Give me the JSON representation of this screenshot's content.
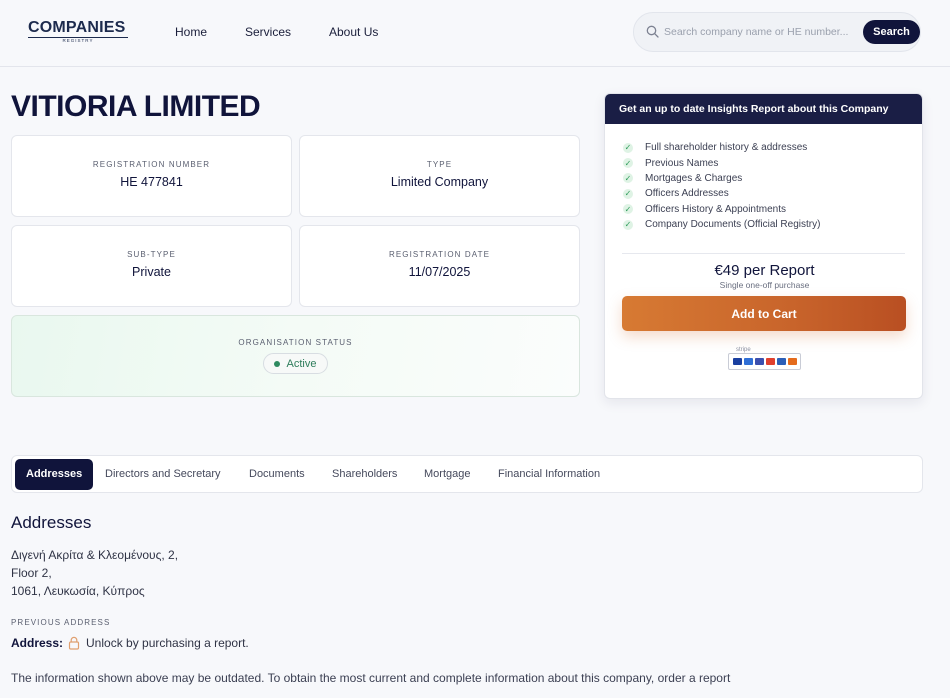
{
  "header": {
    "logo_text": "COMPANIES",
    "logo_sub": "REGISTRY",
    "nav": [
      "Home",
      "Services",
      "About Us"
    ],
    "search_placeholder": "Search company name or HE number...",
    "search_button": "Search"
  },
  "company": {
    "name": "VITIORIA LIMITED",
    "registration_number_label": "REGISTRATION NUMBER",
    "registration_number": "HE 477841",
    "type_label": "TYPE",
    "type": "Limited Company",
    "subtype_label": "SUB-TYPE",
    "subtype": "Private",
    "registration_date_label": "REGISTRATION DATE",
    "registration_date": "11/07/2025",
    "status_label": "ORGANISATION STATUS",
    "status": "Active"
  },
  "report": {
    "heading": "Get an up to date Insights Report about this Company",
    "features": [
      "Full shareholder history & addresses",
      "Previous Names",
      "Mortgages & Charges",
      "Officers Addresses",
      "Officers History & Appointments",
      "Company Documents (Official Registry)"
    ],
    "price": "€49 per Report",
    "price_note": "Single one-off purchase",
    "cart_button": "Add to Cart",
    "payment_label": "stripe"
  },
  "tabs": [
    "Addresses",
    "Directors and Secretary",
    "Documents",
    "Shareholders",
    "Mortgage",
    "Financial Information"
  ],
  "addresses": {
    "title": "Addresses",
    "lines": [
      "Διγενή Ακρίτα & Κλεομένους, 2,",
      "Floor 2,",
      "1061, Λευκωσία, Κύπρος"
    ],
    "previous_label": "PREVIOUS ADDRESS",
    "address_key": "Address:",
    "address_locked": "Unlock by purchasing a report.",
    "notice": "The information shown above may be outdated. To obtain the most current and complete information about this company, order a report"
  },
  "colors": {
    "navy": "#10143b",
    "accent_orange": "#c8642b",
    "status_green": "#2e8a60"
  }
}
